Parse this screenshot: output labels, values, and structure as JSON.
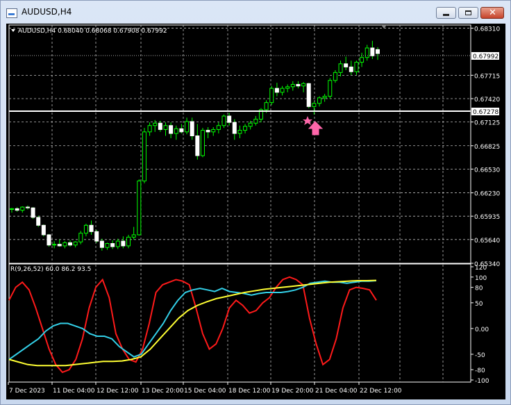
{
  "window": {
    "title": "AUDUSD,H4",
    "min_glyph": "",
    "max_glyph": "",
    "close_glyph": "✕"
  },
  "chart": {
    "info_label": "AUDUSD,H4  0.68040 0.68068 0.67908 0.67992",
    "price_ticks": [
      "0.68310",
      "0.67992",
      "0.67715",
      "0.67420",
      "0.67278",
      "0.67125",
      "0.66825",
      "0.66530",
      "0.66230",
      "0.65935",
      "0.65640",
      "0.65340"
    ],
    "current_price": "0.67992",
    "horizontal_line_price": "0.67278",
    "time_labels": [
      "7 Dec 2023",
      "11 Dec 04:00",
      "12 Dec 12:00",
      "13 Dec 20:00",
      "15 Dec 04:00",
      "18 Dec 12:00",
      "19 Dec 20:00",
      "21 Dec 04:00",
      "22 Dec 12:00"
    ]
  },
  "indicator": {
    "label": "R(9,26,52) 60.0 86.2 93.5",
    "ticks": [
      "120",
      "100",
      "80",
      "50",
      "0.00",
      "-50",
      "-80",
      "-100"
    ]
  },
  "chart_data": {
    "type": "candlestick",
    "title": "AUDUSD,H4",
    "ohlc": [
      [
        0.6602,
        0.6604,
        0.6598,
        0.6603
      ],
      [
        0.6603,
        0.6605,
        0.6599,
        0.6601
      ],
      [
        0.6601,
        0.6606,
        0.6598,
        0.6605
      ],
      [
        0.6605,
        0.6607,
        0.6602,
        0.6604
      ],
      [
        0.6604,
        0.6605,
        0.659,
        0.6592
      ],
      [
        0.6592,
        0.6594,
        0.658,
        0.6582
      ],
      [
        0.6582,
        0.6583,
        0.6568,
        0.657
      ],
      [
        0.657,
        0.6571,
        0.6555,
        0.6557
      ],
      [
        0.6557,
        0.6562,
        0.6553,
        0.6558
      ],
      [
        0.6558,
        0.6564,
        0.6555,
        0.6556
      ],
      [
        0.6556,
        0.6562,
        0.6553,
        0.656
      ],
      [
        0.656,
        0.6563,
        0.6555,
        0.6557
      ],
      [
        0.6557,
        0.6562,
        0.6554,
        0.6561
      ],
      [
        0.6561,
        0.6575,
        0.6558,
        0.6572
      ],
      [
        0.6572,
        0.6584,
        0.6568,
        0.6582
      ],
      [
        0.6582,
        0.6588,
        0.657,
        0.6574
      ],
      [
        0.6574,
        0.6576,
        0.656,
        0.6562
      ],
      [
        0.6562,
        0.6565,
        0.655,
        0.6554
      ],
      [
        0.6554,
        0.656,
        0.6551,
        0.6559
      ],
      [
        0.6559,
        0.6563,
        0.6552,
        0.6555
      ],
      [
        0.6555,
        0.6565,
        0.6552,
        0.6562
      ],
      [
        0.6562,
        0.6568,
        0.6553,
        0.6556
      ],
      [
        0.6556,
        0.657,
        0.6553,
        0.6567
      ],
      [
        0.6567,
        0.658,
        0.6564,
        0.657
      ],
      [
        0.657,
        0.664,
        0.6569,
        0.6638
      ],
      [
        0.6638,
        0.6705,
        0.6635,
        0.67
      ],
      [
        0.67,
        0.6712,
        0.6695,
        0.6708
      ],
      [
        0.6708,
        0.6715,
        0.67,
        0.6711
      ],
      [
        0.6711,
        0.6714,
        0.67,
        0.6703
      ],
      [
        0.6703,
        0.6712,
        0.6695,
        0.6708
      ],
      [
        0.6708,
        0.6712,
        0.6692,
        0.6698
      ],
      [
        0.6698,
        0.6708,
        0.669,
        0.6704
      ],
      [
        0.6704,
        0.671,
        0.6698,
        0.67
      ],
      [
        0.67,
        0.6718,
        0.6697,
        0.6713
      ],
      [
        0.6713,
        0.6718,
        0.669,
        0.6695
      ],
      [
        0.6695,
        0.671,
        0.6665,
        0.667
      ],
      [
        0.667,
        0.6705,
        0.6668,
        0.6702
      ],
      [
        0.6702,
        0.6706,
        0.6692,
        0.67
      ],
      [
        0.67,
        0.6706,
        0.6695,
        0.6703
      ],
      [
        0.6703,
        0.6712,
        0.6698,
        0.6708
      ],
      [
        0.6708,
        0.6722,
        0.6705,
        0.672
      ],
      [
        0.672,
        0.6724,
        0.6708,
        0.6712
      ],
      [
        0.6712,
        0.6716,
        0.669,
        0.6698
      ],
      [
        0.6698,
        0.6708,
        0.6692,
        0.6702
      ],
      [
        0.6702,
        0.671,
        0.6698,
        0.6707
      ],
      [
        0.6707,
        0.6714,
        0.6703,
        0.6711
      ],
      [
        0.6711,
        0.672,
        0.6708,
        0.6716
      ],
      [
        0.6716,
        0.673,
        0.6712,
        0.6728
      ],
      [
        0.6728,
        0.674,
        0.6724,
        0.6737
      ],
      [
        0.6737,
        0.6758,
        0.6734,
        0.6755
      ],
      [
        0.6755,
        0.6762,
        0.6745,
        0.675
      ],
      [
        0.675,
        0.6758,
        0.6746,
        0.6755
      ],
      [
        0.6755,
        0.676,
        0.675,
        0.6757
      ],
      [
        0.6757,
        0.6764,
        0.6752,
        0.676
      ],
      [
        0.676,
        0.6764,
        0.6755,
        0.6758
      ],
      [
        0.6758,
        0.6763,
        0.675,
        0.6761
      ],
      [
        0.6761,
        0.6762,
        0.673,
        0.6732
      ],
      [
        0.6732,
        0.6738,
        0.6722,
        0.6736
      ],
      [
        0.6736,
        0.6745,
        0.6732,
        0.6743
      ],
      [
        0.6743,
        0.6748,
        0.6738,
        0.6745
      ],
      [
        0.6745,
        0.6768,
        0.6742,
        0.6765
      ],
      [
        0.6765,
        0.6778,
        0.6762,
        0.6775
      ],
      [
        0.6775,
        0.679,
        0.677,
        0.6786
      ],
      [
        0.6786,
        0.6795,
        0.6778,
        0.6782
      ],
      [
        0.6782,
        0.679,
        0.6772,
        0.6776
      ],
      [
        0.6776,
        0.679,
        0.6772,
        0.6788
      ],
      [
        0.6788,
        0.68,
        0.6782,
        0.6794
      ],
      [
        0.6794,
        0.681,
        0.679,
        0.6806
      ],
      [
        0.6806,
        0.6815,
        0.6792,
        0.6796
      ],
      [
        0.6804,
        0.6807,
        0.6791,
        0.6799
      ]
    ],
    "ohlc_fields": [
      "open",
      "high",
      "low",
      "close"
    ],
    "horizontal_line": 0.67278,
    "marker_index": 60,
    "ylim": [
      0.6534,
      0.6835
    ],
    "rsi_series": [
      {
        "name": "red",
        "color": "#ff1a1a",
        "ylim": [
          -100,
          120
        ],
        "values": [
          55,
          80,
          90,
          75,
          40,
          0,
          -40,
          -70,
          -85,
          -80,
          -60,
          -20,
          40,
          80,
          95,
          60,
          -10,
          -40,
          -60,
          -65,
          -40,
          10,
          70,
          85,
          90,
          95,
          92,
          85,
          40,
          -10,
          -40,
          -30,
          0,
          40,
          55,
          45,
          30,
          35,
          50,
          60,
          80,
          95,
          100,
          95,
          85,
          20,
          -30,
          -70,
          -60,
          -20,
          40,
          75,
          80,
          78,
          75,
          55
        ]
      },
      {
        "name": "cyan",
        "color": "#33d0e8",
        "ylim": [
          -100,
          120
        ],
        "values": [
          -60,
          -50,
          -40,
          -30,
          -20,
          -5,
          5,
          10,
          10,
          5,
          0,
          -10,
          -15,
          -15,
          -20,
          -35,
          -45,
          -55,
          -50,
          -30,
          -10,
          10,
          35,
          55,
          70,
          75,
          78,
          75,
          72,
          78,
          72,
          70,
          68,
          65,
          68,
          70,
          70,
          70,
          72,
          75,
          80,
          88,
          90,
          92,
          90,
          90,
          88,
          90,
          92,
          92,
          93
        ]
      },
      {
        "name": "yellow",
        "color": "#ffff33",
        "ylim": [
          -100,
          120
        ],
        "values": [
          -60,
          -65,
          -70,
          -72,
          -72,
          -72,
          -72,
          -70,
          -68,
          -66,
          -64,
          -64,
          -63,
          -60,
          -55,
          -40,
          -20,
          0,
          20,
          35,
          45,
          52,
          58,
          62,
          66,
          70,
          73,
          76,
          78,
          80,
          82,
          84,
          86,
          88,
          90,
          91,
          92,
          93,
          93,
          93.5
        ]
      }
    ]
  }
}
